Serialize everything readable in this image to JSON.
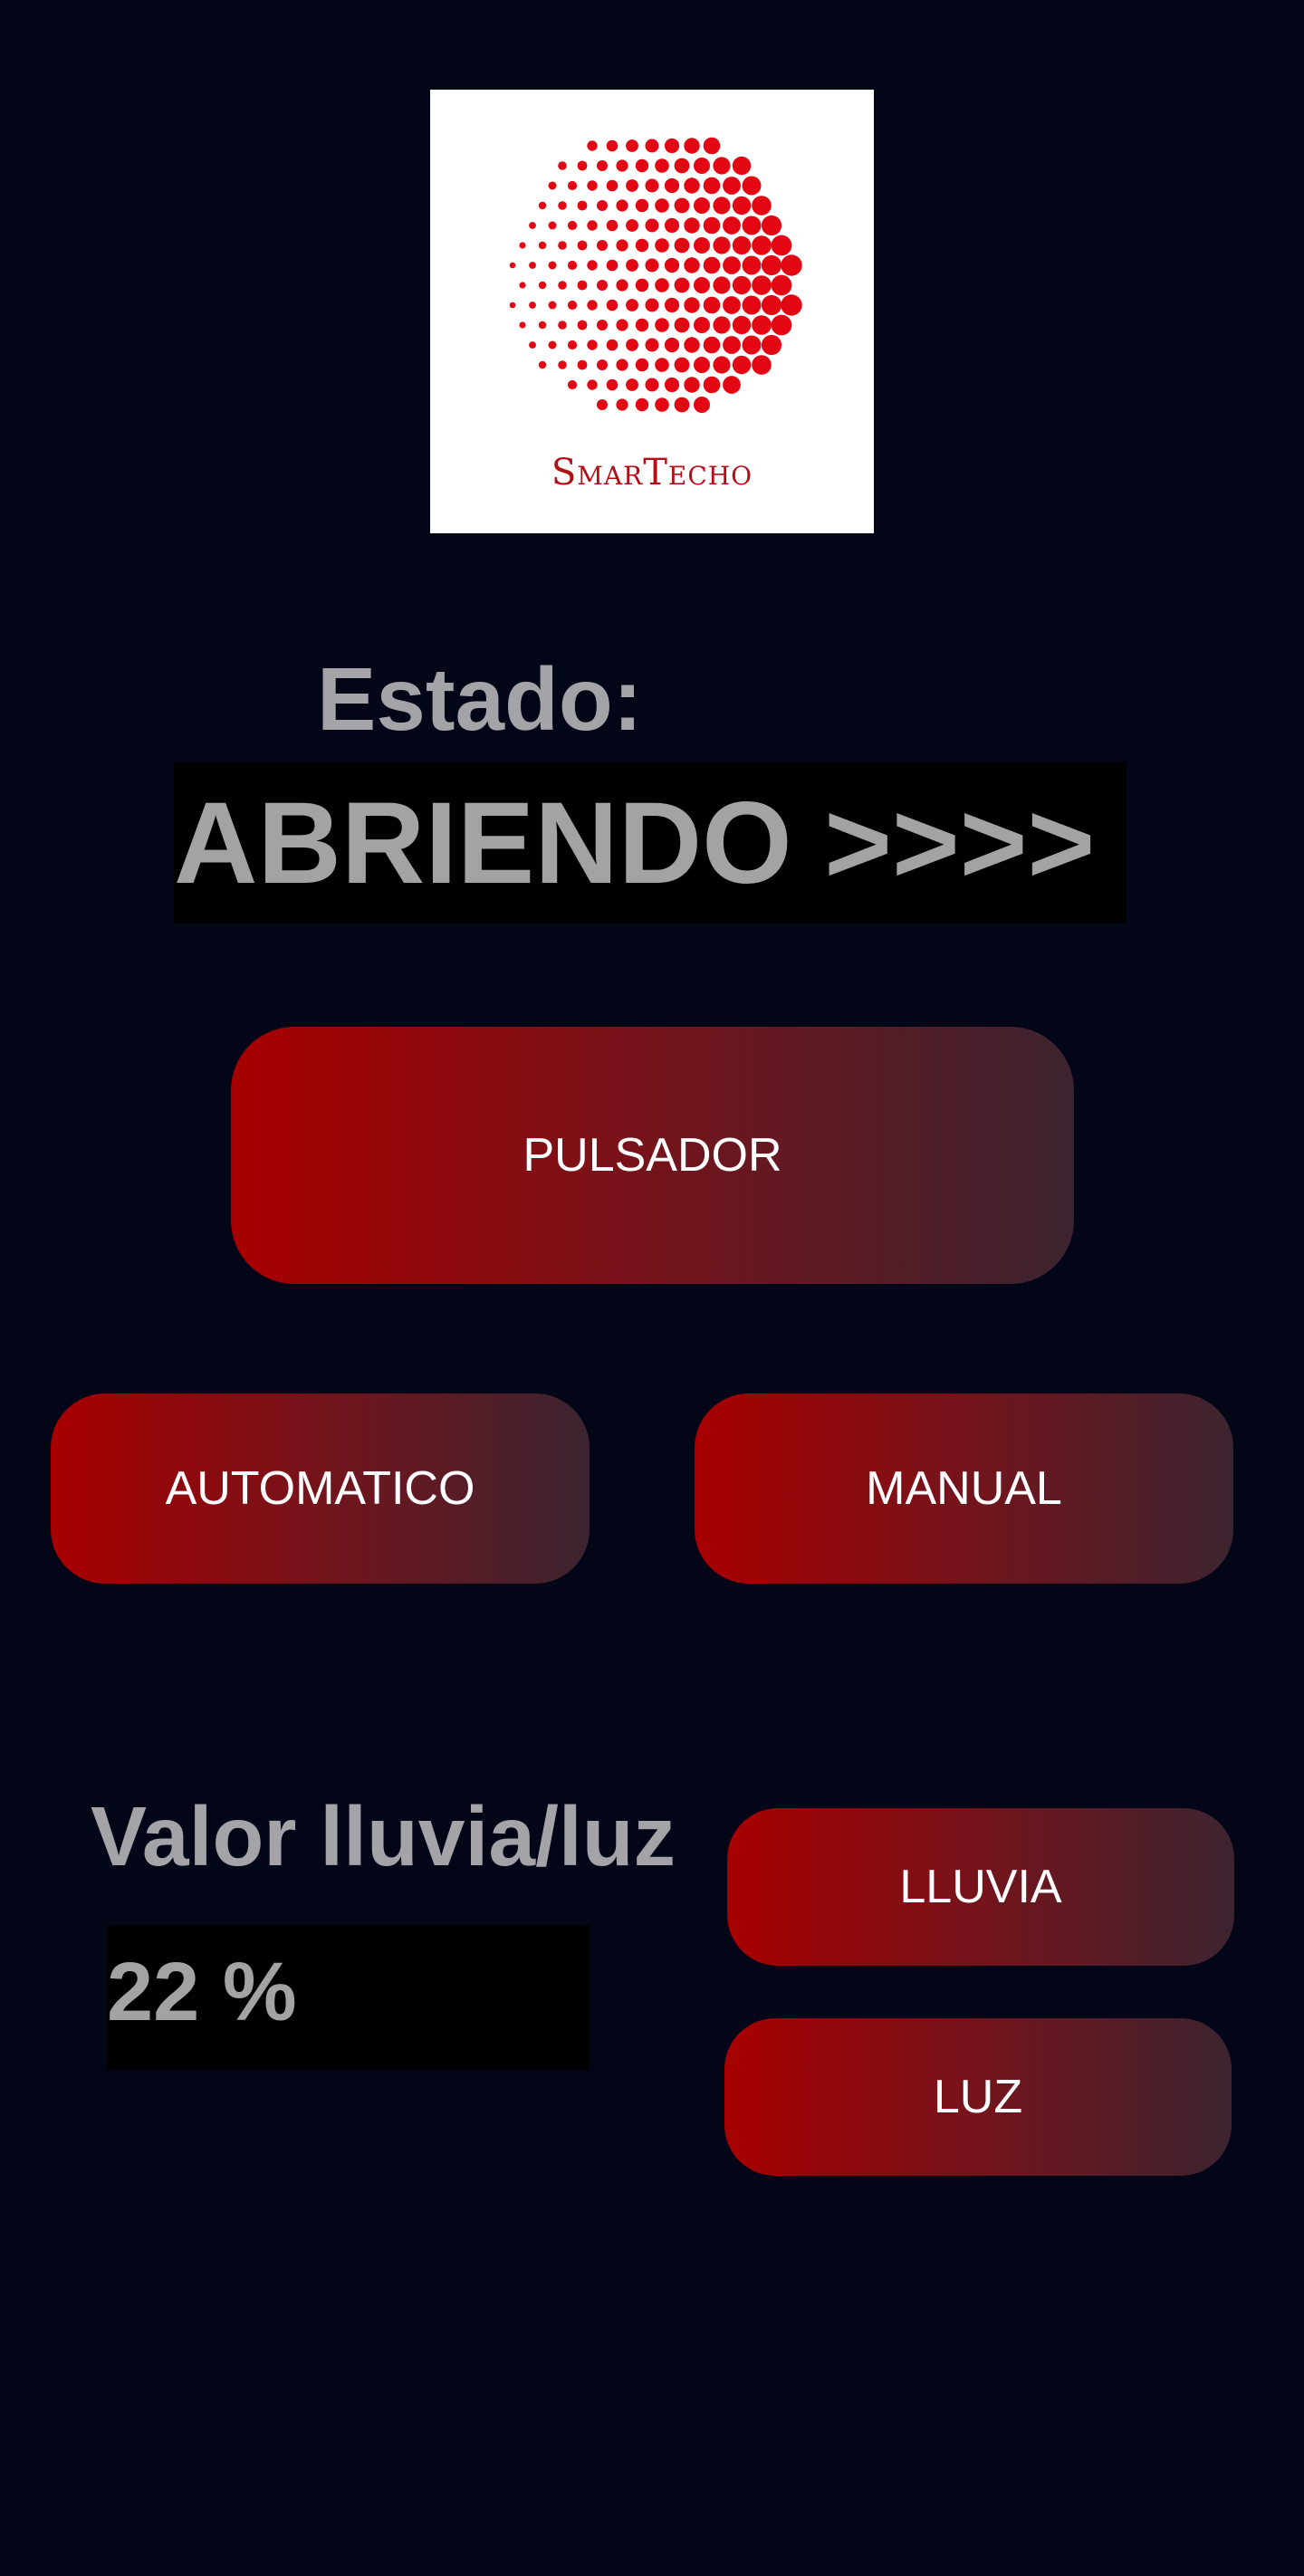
{
  "logo": {
    "text": "SmarTecho",
    "colors": {
      "primary": "#e30613",
      "text": "#b50d16",
      "background": "#ffffff"
    }
  },
  "status": {
    "label": "Estado:",
    "value": "ABRIENDO >>>>"
  },
  "buttons": {
    "pulsador": "PULSADOR",
    "automatico": "AUTOMATICO",
    "manual": "MANUAL",
    "lluvia": "LLUVIA",
    "luz": "LUZ"
  },
  "sensor": {
    "label": "Valor lluvia/luz",
    "value": "22 %"
  },
  "theme": {
    "background": "#020617",
    "button_gradient_start": "#a80000",
    "button_gradient_end": "#3c2430",
    "text_gray": "#a3a3a8"
  }
}
